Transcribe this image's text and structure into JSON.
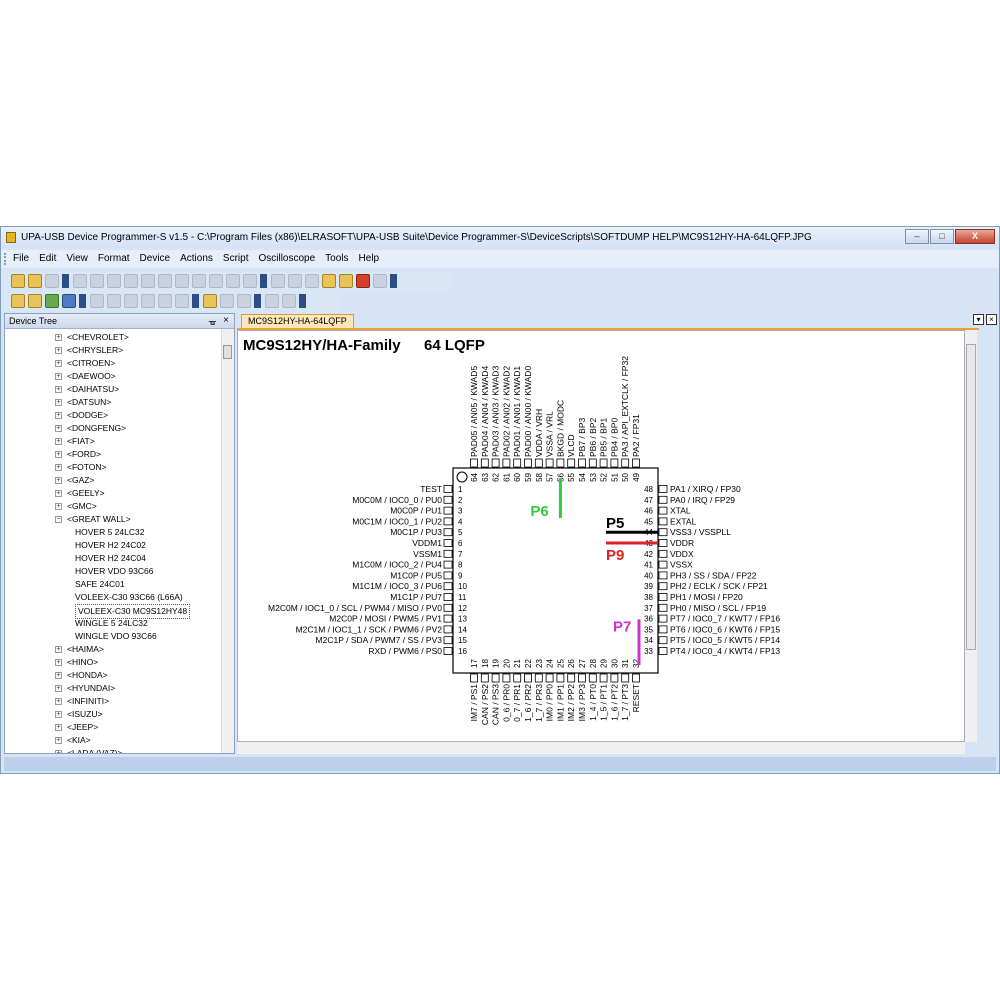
{
  "window": {
    "title": "UPA-USB Device Programmer-S v1.5 - C:\\Program Files (x86)\\ELRASOFT\\UPA-USB Suite\\Device Programmer-S\\DeviceScripts\\SOFTDUMP HELP\\MC9S12HY-HA-64LQFP.JPG",
    "minimize": "–",
    "maximize": "□",
    "close": "X"
  },
  "menu": [
    "File",
    "Edit",
    "View",
    "Format",
    "Device",
    "Actions",
    "Script",
    "Oscilloscope",
    "Tools",
    "Help"
  ],
  "device_tree": {
    "title": "Device Tree",
    "pin": "ᚗ",
    "close": "×",
    "items": [
      {
        "label": "<CHEVROLET>",
        "level": 0
      },
      {
        "label": "<CHRYSLER>",
        "level": 0
      },
      {
        "label": "<CITROEN>",
        "level": 0
      },
      {
        "label": "<DAEWOO>",
        "level": 0
      },
      {
        "label": "<DAIHATSU>",
        "level": 0
      },
      {
        "label": "<DATSUN>",
        "level": 0
      },
      {
        "label": "<DODGE>",
        "level": 0
      },
      {
        "label": "<DONGFENG>",
        "level": 0
      },
      {
        "label": "<FIAT>",
        "level": 0
      },
      {
        "label": "<FORD>",
        "level": 0
      },
      {
        "label": "<FOTON>",
        "level": 0
      },
      {
        "label": "<GAZ>",
        "level": 0
      },
      {
        "label": "<GEELY>",
        "level": 0
      },
      {
        "label": "<GMC>",
        "level": 0
      },
      {
        "label": "<GREAT WALL>",
        "level": 0,
        "expanded": true
      },
      {
        "label": "HOVER 5 24LC32",
        "level": 1
      },
      {
        "label": "HOVER H2 24C02",
        "level": 1
      },
      {
        "label": "HOVER H2 24C04",
        "level": 1
      },
      {
        "label": "HOVER VDO 93C66",
        "level": 1
      },
      {
        "label": "SAFE 24C01",
        "level": 1
      },
      {
        "label": "VOLEEX-C30 93C66 (L66A)",
        "level": 1
      },
      {
        "label": "VOLEEX-C30 MC9S12HY48",
        "level": 1,
        "selected": true
      },
      {
        "label": "WINGLE 5 24LC32",
        "level": 1
      },
      {
        "label": "WINGLE VDO 93C66",
        "level": 1
      },
      {
        "label": "<HAIMA>",
        "level": 0
      },
      {
        "label": "<HINO>",
        "level": 0
      },
      {
        "label": "<HONDA>",
        "level": 0
      },
      {
        "label": "<HYUNDAI>",
        "level": 0
      },
      {
        "label": "<INFINITI>",
        "level": 0
      },
      {
        "label": "<ISUZU>",
        "level": 0
      },
      {
        "label": "<JEEP>",
        "level": 0
      },
      {
        "label": "<KIA>",
        "level": 0
      },
      {
        "label": "<LADA (VAZ)>",
        "level": 0
      }
    ]
  },
  "document_tab": "MC9S12HY-HA-64LQFP",
  "tab_buttons": [
    "▾",
    "×"
  ],
  "diagram": {
    "title": "MC9S12HY/HA-Family",
    "package": "64 LQFP",
    "left_pins": [
      {
        "n": "1",
        "label": "TEST"
      },
      {
        "n": "2",
        "label": "M0C0M / IOC0_0 / PU0"
      },
      {
        "n": "3",
        "label": "M0C0P / PU1"
      },
      {
        "n": "4",
        "label": "M0C1M / IOC0_1 / PU2"
      },
      {
        "n": "5",
        "label": "M0C1P / PU3"
      },
      {
        "n": "6",
        "label": "VDDM1"
      },
      {
        "n": "7",
        "label": "VSSM1"
      },
      {
        "n": "8",
        "label": "M1C0M / IOC0_2 / PU4"
      },
      {
        "n": "9",
        "label": "M1C0P / PU5"
      },
      {
        "n": "10",
        "label": "M1C1M / IOC0_3 / PU6"
      },
      {
        "n": "11",
        "label": "M1C1P / PU7"
      },
      {
        "n": "12",
        "label": "M2C0M / IOC1_0 / SCL / PWM4 / MISO / PV0"
      },
      {
        "n": "13",
        "label": "M2C0P / MOSI / PWM5 / PV1"
      },
      {
        "n": "14",
        "label": "M2C1M / IOC1_1 / SCK / PWM6 / PV2"
      },
      {
        "n": "15",
        "label": "M2C1P / SDA / PWM7 / SS / PV3"
      },
      {
        "n": "16",
        "label": "RXD / PWM6 / PS0"
      }
    ],
    "right_pins": [
      {
        "n": "48",
        "label": "PA1 / XIRQ / FP30"
      },
      {
        "n": "47",
        "label": "PA0 / IRQ / FP29"
      },
      {
        "n": "46",
        "label": "XTAL"
      },
      {
        "n": "45",
        "label": "EXTAL"
      },
      {
        "n": "44",
        "label": "VSS3 / VSSPLL"
      },
      {
        "n": "43",
        "label": "VDDR"
      },
      {
        "n": "42",
        "label": "VDDX"
      },
      {
        "n": "41",
        "label": "VSSX"
      },
      {
        "n": "40",
        "label": "PH3 / SS / SDA / FP22"
      },
      {
        "n": "39",
        "label": "PH2 / ECLK / SCK / FP21"
      },
      {
        "n": "38",
        "label": "PH1 / MOSI / FP20"
      },
      {
        "n": "37",
        "label": "PH0 / MISO / SCL / FP19"
      },
      {
        "n": "36",
        "label": "PT7 / IOC0_7 / KWT7 / FP16"
      },
      {
        "n": "35",
        "label": "PT6 / IOC0_6 / KWT6 / FP15"
      },
      {
        "n": "34",
        "label": "PT5 / IOC0_5 / KWT5 / FP14"
      },
      {
        "n": "33",
        "label": "PT4 / IOC0_4 / KWT4 / FP13"
      }
    ],
    "top_pins": [
      {
        "n": "64",
        "label": "PAD05 / AN05 / KWAD5"
      },
      {
        "n": "63",
        "label": "PAD04 / AN04 / KWAD4"
      },
      {
        "n": "62",
        "label": "PAD03 / AN03 / KWAD3"
      },
      {
        "n": "61",
        "label": "PAD02 / AN02 / KWAD2"
      },
      {
        "n": "60",
        "label": "PAD01 / AN01 / KWAD1"
      },
      {
        "n": "59",
        "label": "PAD00 / AN00 / KWAD0"
      },
      {
        "n": "58",
        "label": "VDDA / VRH"
      },
      {
        "n": "57",
        "label": "VSSA / VRL"
      },
      {
        "n": "56",
        "label": "BKGD / MODC"
      },
      {
        "n": "55",
        "label": "VLCD"
      },
      {
        "n": "54",
        "label": "PB7 / BP3"
      },
      {
        "n": "53",
        "label": "PB6 / BP2"
      },
      {
        "n": "52",
        "label": "PB5 / BP1"
      },
      {
        "n": "51",
        "label": "PB4 / BP0"
      },
      {
        "n": "50",
        "label": "PA3 / API_EXTCLK / FP32"
      },
      {
        "n": "49",
        "label": "PA2 / FP31"
      }
    ],
    "bottom_pins": [
      {
        "n": "17",
        "label": "IM7 / PS1"
      },
      {
        "n": "18",
        "label": "CAN / PS2"
      },
      {
        "n": "19",
        "label": "CAN / PS3"
      },
      {
        "n": "20",
        "label": "0_6 / PR0"
      },
      {
        "n": "21",
        "label": "0_7 / PR1"
      },
      {
        "n": "22",
        "label": "1_6 / PR2"
      },
      {
        "n": "23",
        "label": "1_7 / PR3"
      },
      {
        "n": "24",
        "label": "IM0 / PP0"
      },
      {
        "n": "25",
        "label": "IM1 / PP1"
      },
      {
        "n": "26",
        "label": "IM2 / PP2"
      },
      {
        "n": "27",
        "label": "IM3 / PP3"
      },
      {
        "n": "28",
        "label": "1_4 / PT0"
      },
      {
        "n": "29",
        "label": "1_5 / PT1"
      },
      {
        "n": "30",
        "label": "1_6 / PT2"
      },
      {
        "n": "31",
        "label": "1_7 / PT3"
      },
      {
        "n": "32",
        "label": "RESET"
      }
    ],
    "markers": [
      {
        "label": "P6",
        "color": "#33cc33"
      },
      {
        "label": "P5",
        "color": "#000000"
      },
      {
        "label": "P9",
        "color": "#dd2222"
      },
      {
        "label": "P7",
        "color": "#cc33cc"
      }
    ]
  }
}
